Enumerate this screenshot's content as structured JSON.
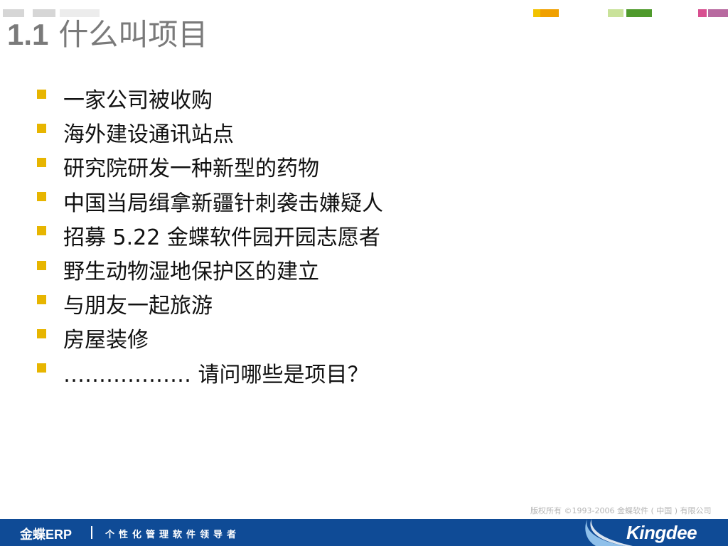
{
  "title": {
    "number": "1.1",
    "text": "什么叫项目"
  },
  "bullets": [
    "一家公司被收购",
    "海外建设通讯站点",
    "研究院研发一种新型的药物",
    "中国当局缉拿新疆针刺袭击嫌疑人",
    "招募 5.22 金蝶软件园开园志愿者",
    "野生动物湿地保护区的建立",
    "与朋友一起旅游",
    "房屋装修",
    "……………… 请问哪些是项目？"
  ],
  "copyright": "版权所有 ©1993-2006 金蝶软件 ( 中国 ) 有限公司",
  "footer": {
    "brand": "金蝶ERP",
    "slogan": "个性化管理软件领导者",
    "logo": "Kingdee"
  },
  "colors": {
    "bullet": "#e7b500",
    "footer_bg": "#0f4b96",
    "title": "#7a7a7a"
  }
}
